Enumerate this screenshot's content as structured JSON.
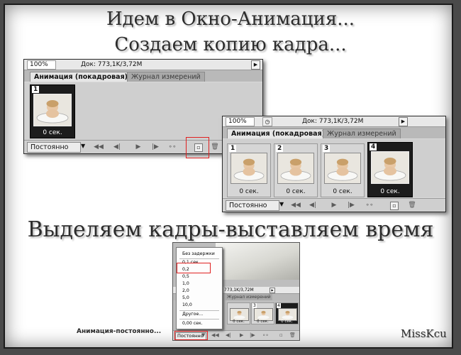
{
  "headings": {
    "line1": "Идем в Окно-Анимация...",
    "line2": "Создаем копию кадра...",
    "line3": "Выделяем кадры-выставляем время"
  },
  "panel1": {
    "zoom": "100%",
    "doc_info": "Док: 773,1K/3,72M",
    "tab_active": "Анимация (покадровая)",
    "tab_inactive": "Журнал измерений",
    "frames": [
      {
        "number": "1",
        "delay": "0 сек.",
        "selected": true
      }
    ],
    "loop_label": "Постоянно"
  },
  "panel2": {
    "zoom": "100%",
    "doc_info": "Док: 773,1K/3,72M",
    "tab_active": "Анимация (покадровая)",
    "tab_inactive": "Журнал измерений",
    "frames": [
      {
        "number": "1",
        "delay": "0 сек.",
        "selected": false
      },
      {
        "number": "2",
        "delay": "0 сек.",
        "selected": false
      },
      {
        "number": "3",
        "delay": "0 сек.",
        "selected": false
      },
      {
        "number": "4",
        "delay": "0 сек.",
        "selected": true
      }
    ],
    "loop_label": "Постоянно"
  },
  "panel3": {
    "doc_info": "773,1K/3,72M",
    "tab_inactive": "Журнал измерений",
    "delay_menu": [
      "Без задержки",
      "0,1 сек.",
      "0,2",
      "0,5",
      "1,0",
      "2,0",
      "5,0",
      "10,0",
      "Другое...",
      "0,00 сек."
    ],
    "highlighted_item": "0,2",
    "frames": [
      {
        "number": "",
        "delay": "0 сек."
      },
      {
        "number": "3",
        "delay": "0 сек."
      },
      {
        "number": "4",
        "delay": "0 сек."
      }
    ],
    "loop_label": "Постоянно"
  },
  "caption": "Анимация-постоянно...",
  "signature": "MissKcu",
  "colors": {
    "highlight": "#e02020",
    "panel_bg": "#d9d9d9",
    "selected_frame": "#1c1c1c"
  },
  "icons": [
    "first-frame-icon",
    "prev-frame-icon",
    "play-icon",
    "next-frame-icon",
    "tween-icon",
    "duplicate-frame-icon",
    "trash-icon",
    "clock-icon"
  ]
}
